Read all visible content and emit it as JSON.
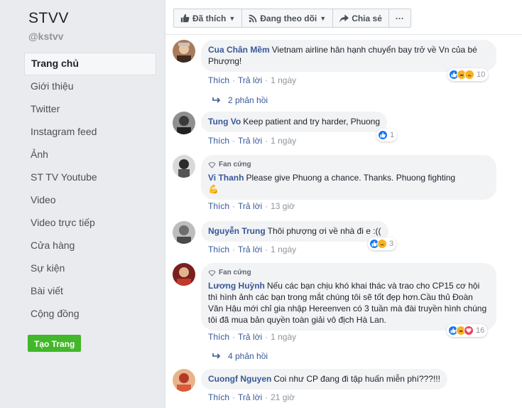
{
  "page": {
    "name": "STVV",
    "handle": "@kstvv"
  },
  "nav": [
    {
      "label": "Trang chủ"
    },
    {
      "label": "Giới thiệu"
    },
    {
      "label": "Twitter"
    },
    {
      "label": "Instagram feed"
    },
    {
      "label": "Ảnh"
    },
    {
      "label": "ST TV Youtube"
    },
    {
      "label": "Video"
    },
    {
      "label": "Video trực tiếp"
    },
    {
      "label": "Cửa hàng"
    },
    {
      "label": "Sự kiện"
    },
    {
      "label": "Bài viết"
    },
    {
      "label": "Cộng đồng"
    }
  ],
  "create_page_label": "Tạo Trang",
  "actions": {
    "liked": "Đã thích",
    "following": "Đang theo dõi",
    "share": "Chia sẻ",
    "more": "···"
  },
  "labels": {
    "like": "Thích",
    "reply": "Trả lời",
    "fan": "Fan cứng"
  },
  "comments": [
    {
      "author": "Cua Chân Mềm",
      "text": "Vietnam airline hân hạnh chuyển bay trở về Vn của bé Phượng!",
      "time": "1 ngày",
      "reactions": "10",
      "replies": "2 phản hồi"
    },
    {
      "author": "Tung Vo",
      "text": "Keep patient and try harder, Phuong",
      "time": "1 ngày",
      "reactions": "1"
    },
    {
      "author": "Vi Thanh",
      "text": "Please give Phuong a chance. Thanks. Phuong fighting",
      "emoji": "💪",
      "time": "13 giờ"
    },
    {
      "author": "Nguyễn Trung",
      "text": "Thôi phượng ơi về nhà đi e :((",
      "time": "1 ngày",
      "reactions": "3"
    },
    {
      "author": "Lương Huỳnh",
      "text": "Nếu các bạn chịu khó khai thác và trao cho CP15 cơ hội thì hình ảnh các bạn trong mắt chúng tôi sẽ tốt đẹp hơn.Cầu thủ Đoàn Văn Hậu mới chỉ gia nhập Hereenven có 3 tuần mà đài truyền hình chúng tôi đã mua bản quyền toàn giải vô địch Hà Lan.",
      "time": "1 ngày",
      "reactions": "16",
      "replies": "4 phản hồi"
    },
    {
      "author": "Cuongf Nguyen",
      "text": "Coi như CP đang đi tập huấn miễn phí???!!!",
      "time": "21 giờ"
    }
  ]
}
